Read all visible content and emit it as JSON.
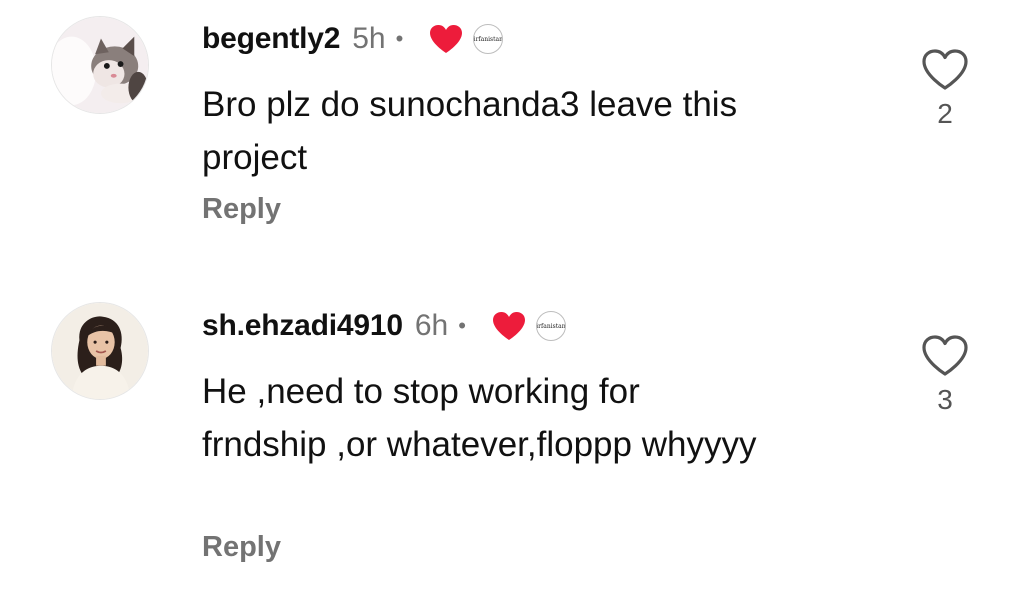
{
  "comments": [
    {
      "username": "begently2",
      "time": "5h",
      "separator": "•",
      "badge_text": "irfanistan",
      "text": "Bro plz do sunochanda3 leave this project",
      "reply_label": "Reply",
      "like_count": "2",
      "avatar": "cat-photo"
    },
    {
      "username": "sh.ehzadi4910",
      "time": "6h",
      "separator": "•",
      "badge_text": "irfanistan",
      "text": "He ,need to stop working for frndship ,or whatever,floppp whyyyy",
      "reply_label": "Reply",
      "like_count": "3",
      "avatar": "woman-photo"
    }
  ],
  "colors": {
    "heart": "#ed1c3b",
    "muted": "#737373",
    "text": "#111111"
  },
  "icons": [
    "heart-outline-icon",
    "heart-filled-icon"
  ]
}
